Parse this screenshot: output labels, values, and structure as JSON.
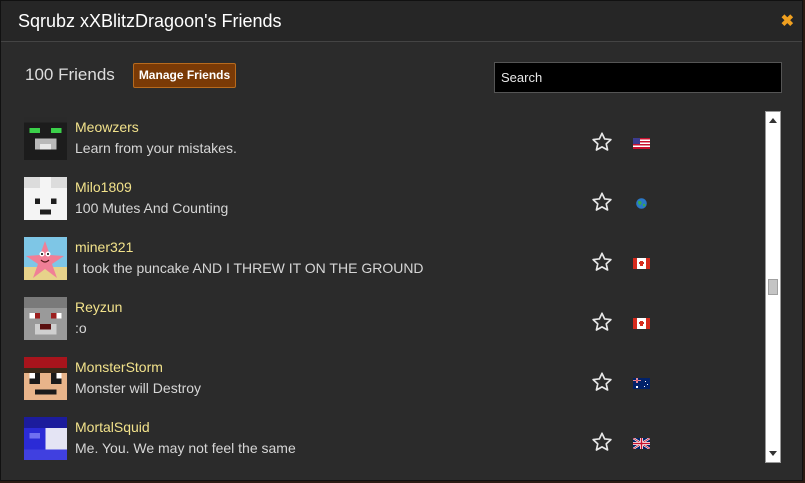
{
  "window": {
    "title": "Sqrubz xXBlitzDragoon's Friends",
    "close_glyph": "✖"
  },
  "header": {
    "friend_count_label": "100 Friends",
    "manage_button_label": "Manage Friends",
    "search_placeholder": "Search",
    "search_value": ""
  },
  "friends": [
    {
      "name": "Meowzers",
      "status": "Learn from your mistakes.",
      "avatar_icon": "cat-skin-avatar",
      "flag": "us-flag-icon"
    },
    {
      "name": "Milo1809",
      "status": "100 Mutes And Counting",
      "avatar_icon": "white-skin-avatar",
      "flag": "globe-flag-icon"
    },
    {
      "name": "miner321",
      "status": "I took the puncake AND I THREW IT ON THE GROUND",
      "avatar_icon": "starfish-avatar",
      "flag": "canada-flag-icon"
    },
    {
      "name": "Reyzun",
      "status": ":o",
      "avatar_icon": "grey-cat-skin-avatar",
      "flag": "canada-flag-icon"
    },
    {
      "name": "MonsterStorm",
      "status": "Monster will Destroy",
      "avatar_icon": "capped-skin-avatar",
      "flag": "australia-flag-icon"
    },
    {
      "name": "MortalSquid",
      "status": "Me. You. We may not feel the same",
      "avatar_icon": "blue-skin-avatar",
      "flag": "uk-flag-icon"
    }
  ],
  "scrollbar": {
    "position_fraction": 0.5
  },
  "colors": {
    "accent_button": "#7a3a06",
    "friend_name": "#f2e28b",
    "close_icon": "#f0a020",
    "panel_bg": "#2b2b2b"
  }
}
